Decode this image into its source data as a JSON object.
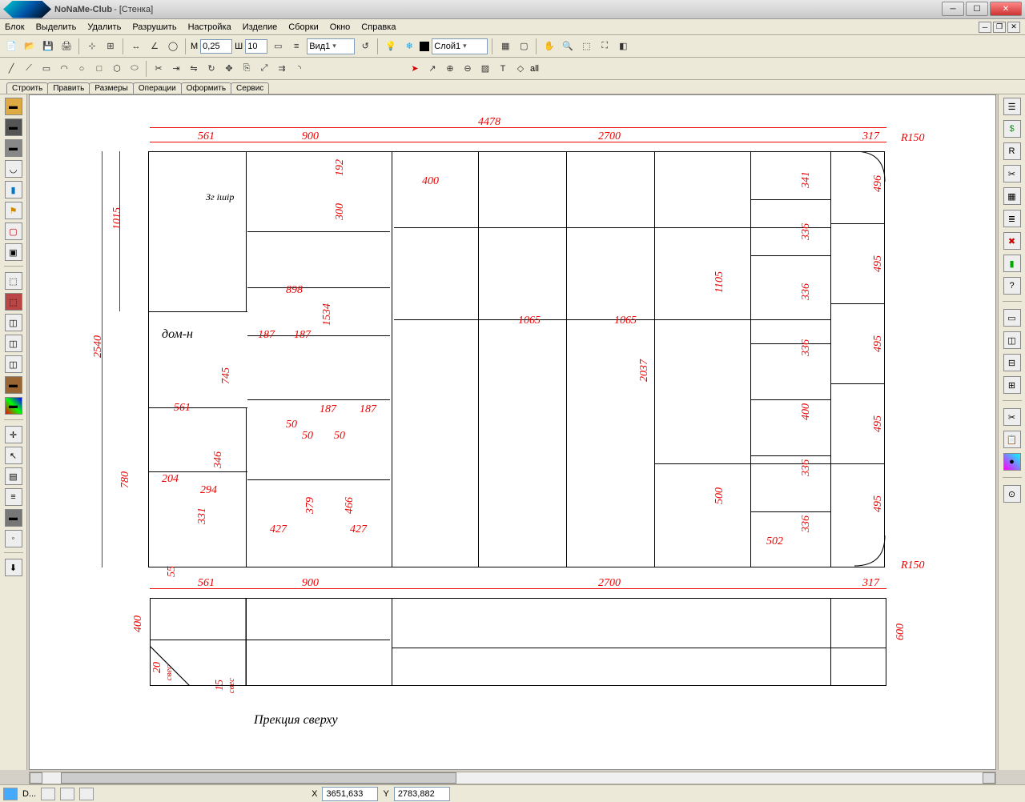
{
  "title": {
    "brand": "NoNaMe-Club",
    "doc_suffix": " - [Стенка]"
  },
  "menu": [
    "Блок",
    "Выделить",
    "Удалить",
    "Разрушить",
    "Настройка",
    "Изделие",
    "Сборки",
    "Окно",
    "Справка"
  ],
  "toolbar1": {
    "m_label": "M",
    "m_value": "0,25",
    "sh_label": "Ш",
    "sh_value": "10",
    "view_combo": "Вид1",
    "layer_combo": "Слой1"
  },
  "tabs": [
    "Строить",
    "Править",
    "Размеры",
    "Операции",
    "Оформить",
    "Сервис"
  ],
  "selector_toolbar_label": "all",
  "status": {
    "x_label": "X",
    "x_value": "3651,633",
    "y_label": "Y",
    "y_value": "2783,882",
    "open_doc": "D..."
  },
  "plan_caption": "Прекция сверху",
  "front_notes": {
    "dom_n": "дом-н",
    "top_note": "Зг ішір"
  },
  "radii": {
    "top": "R150",
    "bottom": "R150"
  },
  "dimensions": {
    "top_total": "4478",
    "top_row": [
      "561",
      "900",
      "2700",
      "317"
    ],
    "left": [
      "1015",
      "2540",
      "745",
      "780",
      "55"
    ],
    "right": [
      "496",
      "495",
      "495",
      "495",
      "495",
      "600",
      "400"
    ],
    "inner_v": [
      "192",
      "300",
      "1534",
      "341",
      "336",
      "1105",
      "336",
      "336",
      "2037",
      "400",
      "336",
      "500",
      "336"
    ],
    "inner_h": [
      "400",
      "898",
      "1065",
      "1065",
      "502",
      "187",
      "187",
      "187",
      "187",
      "50",
      "50",
      "50",
      "561",
      "204",
      "294",
      "346",
      "331",
      "427",
      "379",
      "427",
      "466",
      "15",
      "20"
    ],
    "inner_labels": [
      "свес",
      "свес"
    ],
    "plan_row": [
      "561",
      "900",
      "2700",
      "317"
    ]
  },
  "left_dock_icons": [
    "panel",
    "board",
    "box",
    "arc",
    "detail",
    "explode",
    "sel",
    "group",
    "render",
    "slice",
    "cut",
    "mass",
    "struct",
    "frame",
    "iso",
    "axo",
    "plan",
    "front",
    "side",
    "section",
    "color",
    "gray",
    "mat",
    "line",
    "dot",
    "grid"
  ],
  "right_dock_icons": [
    "tree",
    "money",
    "ruler",
    "cut",
    "align",
    "stock",
    "del",
    "flag",
    "info",
    "node",
    "wnd1",
    "wnd2",
    "wnd3",
    "wnd4",
    "cut2",
    "paste",
    "color",
    "snap"
  ]
}
